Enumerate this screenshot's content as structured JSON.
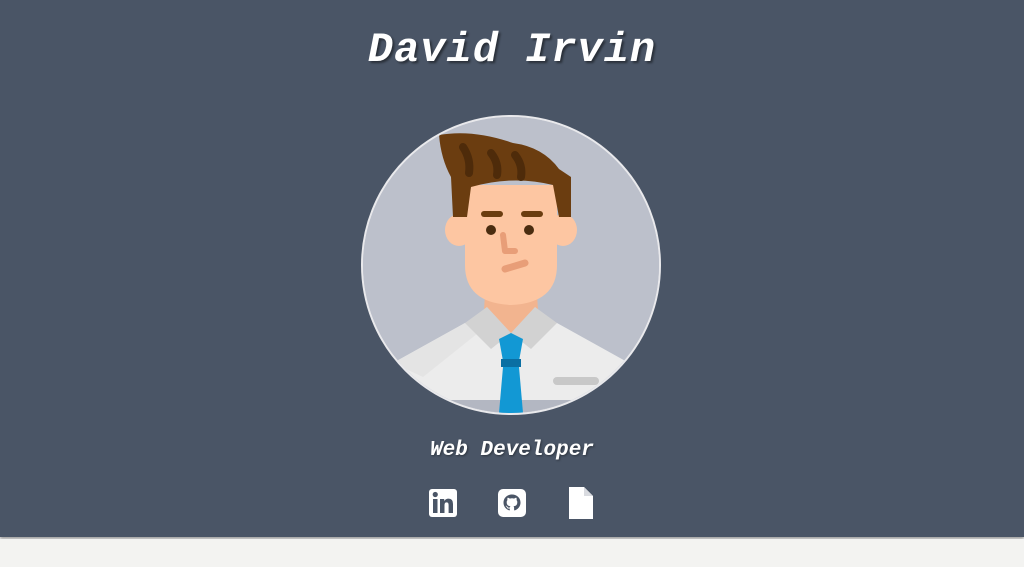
{
  "profile": {
    "name": "David Irvin",
    "role": "Web Developer",
    "avatar_icon": "developer-avatar-illustration"
  },
  "socials": [
    {
      "icon": "linkedin-icon"
    },
    {
      "icon": "github-icon"
    },
    {
      "icon": "document-icon"
    }
  ],
  "colors": {
    "hero_background": "#4a5566",
    "page_background": "#f2f2f2",
    "text": "#ffffff",
    "avatar_background": "#bcc0cb",
    "hair": "#6b3d10",
    "skin": "#fdc6a2",
    "tie": "#1298d4",
    "shirt": "#ececec"
  }
}
